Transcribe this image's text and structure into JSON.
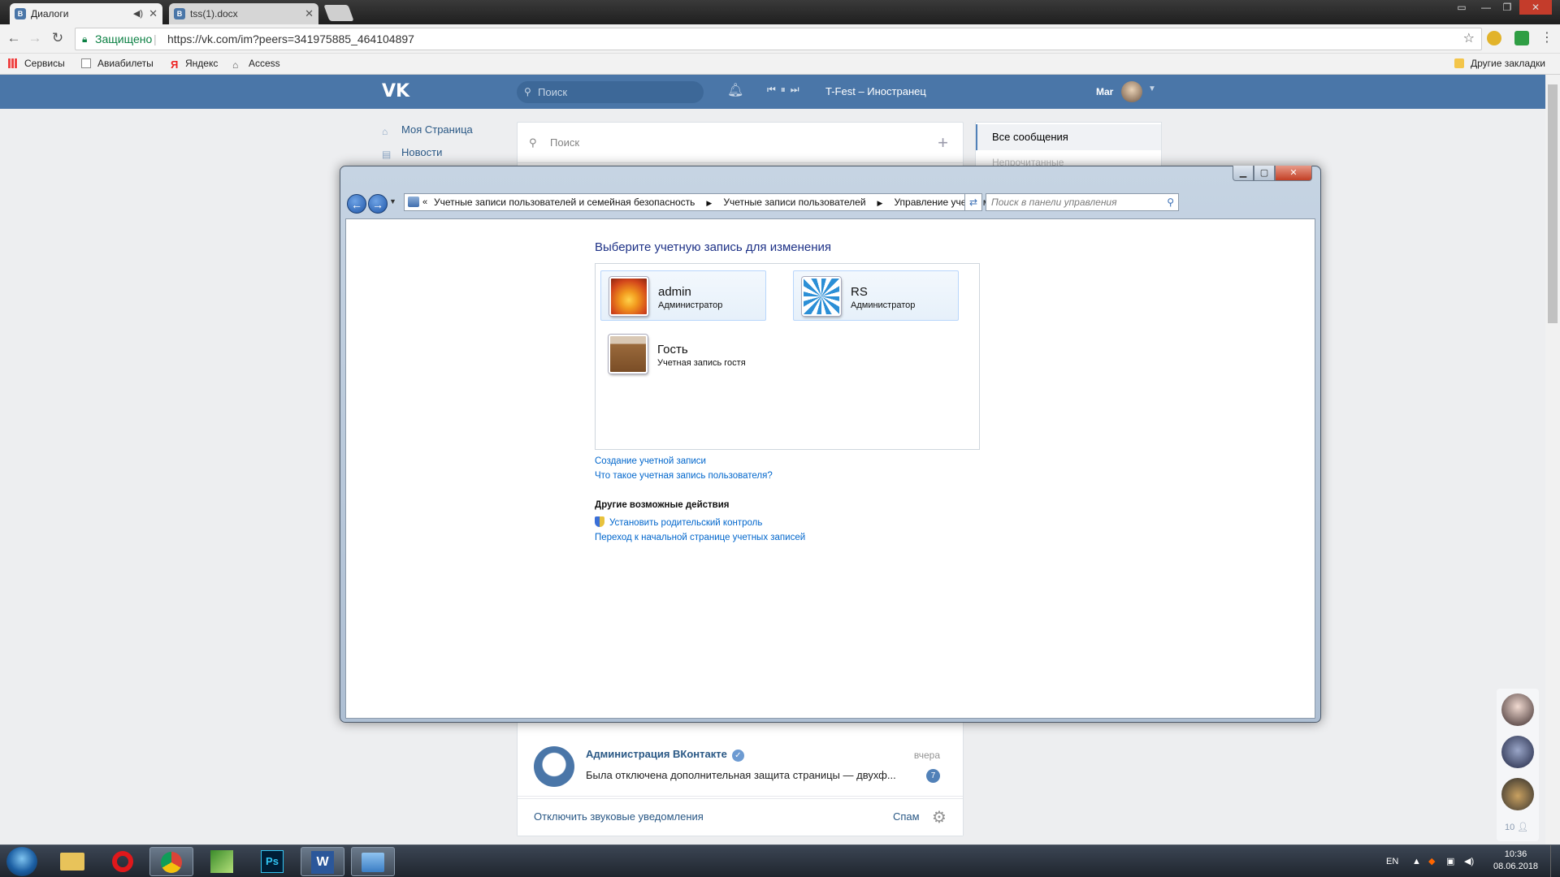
{
  "browser": {
    "tabs": [
      {
        "title": "Диалоги",
        "favicon": "vk-icon",
        "audio": true
      },
      {
        "title": "tss(1).docx",
        "favicon": "vk-icon"
      }
    ],
    "secure_label": "Защищено",
    "url": "https://vk.com/im?peers=341975885_464104897",
    "bookmarks": [
      "Сервисы",
      "Авиабилеты",
      "Яндекс",
      "Access"
    ],
    "other_bookmarks": "Другие закладки"
  },
  "vk": {
    "logo": "VK",
    "search_placeholder": "Поиск",
    "track": "T-Fest – Иностранец",
    "user_name": "Mar",
    "nav": [
      "Моя Страница",
      "Новости"
    ],
    "dialogs_search_placeholder": "Поиск",
    "right_menu": {
      "all_messages": "Все сообщения",
      "unread": "Непрочитанные"
    },
    "dialog": {
      "name": "Администрация ВКонтакте",
      "time": "вчера",
      "message": "Была отключена дополнительная защита страницы — двухф...",
      "unread": "7"
    },
    "footer": {
      "mute": "Отключить звуковые уведомления",
      "spam": "Спам"
    },
    "online_count": "10",
    "accent": "#4a76a8"
  },
  "dialog": {
    "breadcrumb": [
      "Учетные записи пользователей и семейная безопасность",
      "Учетные записи пользователей",
      "Управление учетными записями"
    ],
    "search_placeholder": "Поиск в панели управления",
    "title": "Выберите учетную запись для изменения",
    "accounts": [
      {
        "name": "admin",
        "role": "Администратор",
        "picture": "orange-flower"
      },
      {
        "name": "RS",
        "role": "Администратор",
        "picture": "blue-pinwheel"
      },
      {
        "name": "Гость",
        "role": "Учетная запись гостя",
        "picture": "guest-suitcase"
      }
    ],
    "links": {
      "create": "Создание учетной записи",
      "what_is": "Что такое учетная запись пользователя?"
    },
    "other_actions": "Другие возможные действия",
    "actions": [
      "Установить родительский контроль",
      "Переход к начальной странице учетных записей"
    ]
  },
  "taskbar": {
    "apps": [
      "explorer",
      "opera",
      "chrome",
      "app-green",
      "photoshop",
      "word",
      "control-panel"
    ],
    "lang": "EN",
    "time": "10:36",
    "date": "08.06.2018"
  }
}
